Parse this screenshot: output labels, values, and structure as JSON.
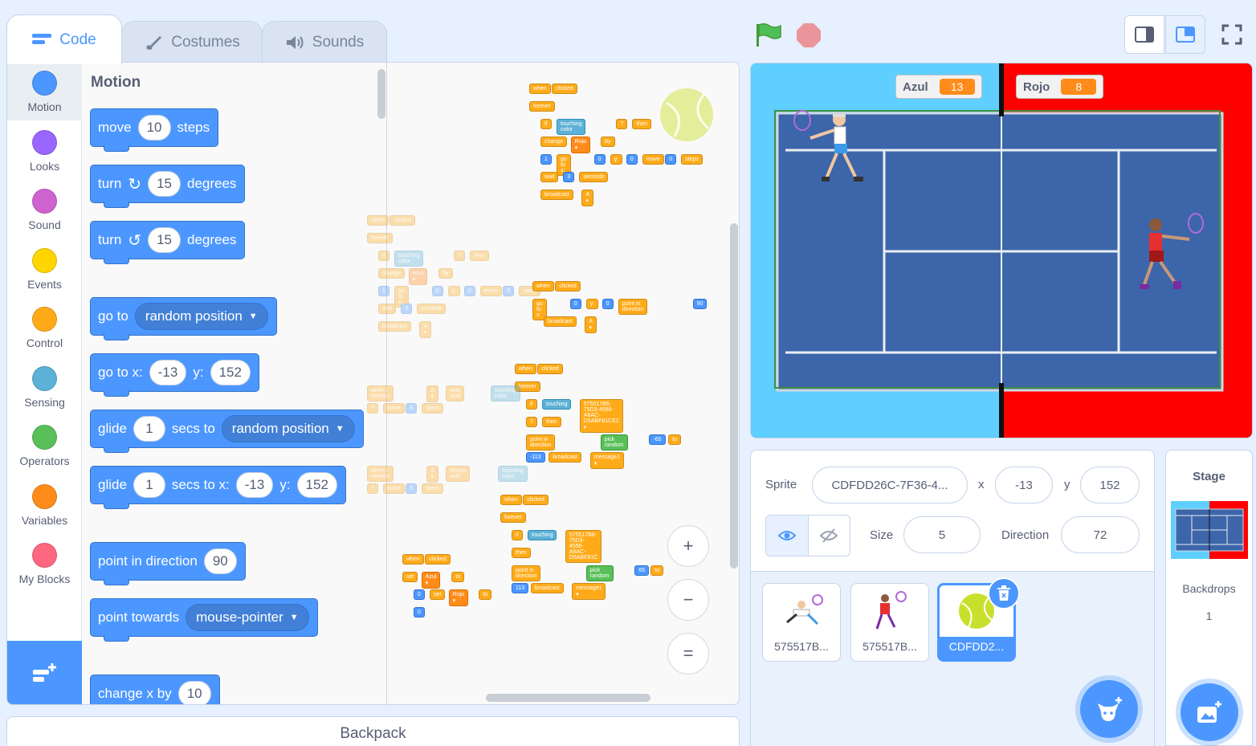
{
  "tabs": {
    "code": "Code",
    "costumes": "Costumes",
    "sounds": "Sounds"
  },
  "categories": [
    {
      "label": "Motion",
      "color": "#4c97ff"
    },
    {
      "label": "Looks",
      "color": "#9966ff"
    },
    {
      "label": "Sound",
      "color": "#cf63cf"
    },
    {
      "label": "Events",
      "color": "#ffd500"
    },
    {
      "label": "Control",
      "color": "#ffab19"
    },
    {
      "label": "Sensing",
      "color": "#5cb1d6"
    },
    {
      "label": "Operators",
      "color": "#59c059"
    },
    {
      "label": "Variables",
      "color": "#ff8c1a"
    },
    {
      "label": "My Blocks",
      "color": "#ff6680"
    }
  ],
  "palette": {
    "title": "Motion",
    "move": {
      "a": "move",
      "n": "10",
      "b": "steps"
    },
    "turn_right": {
      "a": "turn",
      "n": "15",
      "b": "degrees"
    },
    "turn_left": {
      "a": "turn",
      "n": "15",
      "b": "degrees"
    },
    "go_to": {
      "a": "go to",
      "menu": "random position"
    },
    "go_to_xy": {
      "a": "go to x:",
      "x": "-13",
      "b": "y:",
      "y": "152"
    },
    "glide_to": {
      "a": "glide",
      "n": "1",
      "b": "secs to",
      "menu": "random position"
    },
    "glide_xy": {
      "a": "glide",
      "n": "1",
      "b": "secs to x:",
      "x": "-13",
      "c": "y:",
      "y": "152"
    },
    "point_dir": {
      "a": "point in direction",
      "n": "90"
    },
    "point_towards": {
      "a": "point towards",
      "menu": "mouse-pointer"
    },
    "change_x": {
      "a": "change x by",
      "n": "10"
    }
  },
  "scripts": {
    "s1": [
      "when",
      "clicked",
      "forever",
      "if",
      "touching color",
      "?",
      "then",
      "change",
      "Rojo ▾",
      "by",
      "1",
      "go to x:",
      "0",
      "y:",
      "0",
      "move",
      "0",
      "steps",
      "wait",
      "3",
      "seconds",
      "broadcast",
      "A ▾"
    ],
    "s2": [
      "when",
      "clicked",
      "forever",
      "if",
      "touching color",
      "?",
      "then",
      "change",
      "Azul ▾",
      "by",
      "1",
      "go to x:",
      "0",
      "y:",
      "0",
      "move",
      "0",
      "steps",
      "wait",
      "3",
      "seconds",
      "broadcast",
      "A ▾"
    ],
    "s3": [
      "when",
      "clicked",
      "go to x:",
      "0",
      "y:",
      "0",
      "point in direction",
      "90",
      "broadcast",
      "A ▾"
    ],
    "s4": [
      "when",
      "clicked",
      "forever",
      "if",
      "touching",
      "575517B6-75D3-4556-A6AC-D5ABF81CE2 ▾",
      "?",
      "then",
      "point in direction",
      "pick random",
      "-65",
      "to",
      "-113",
      "broadcast",
      "message1 ▾"
    ],
    "s5": [
      "when I receive",
      "A ▾",
      "wait until",
      "touching color",
      "?",
      "move",
      "5",
      "steps"
    ],
    "s6": [
      "when I receive",
      "A ▾",
      "repeat until",
      "touching color",
      "?",
      "move",
      "5",
      "steps"
    ],
    "s7": [
      "when",
      "clicked",
      "set",
      "Azul ▾",
      "to",
      "0",
      "set",
      "Rojo ▾",
      "to",
      "0"
    ],
    "s8": [
      "when",
      "clicked",
      "forever",
      "if",
      "touching",
      "575517B6-75D3-4556-A6AC-D5ABF81C",
      "then",
      "point in direction",
      "pick random",
      "65",
      "to",
      "113",
      "broadcast",
      "message1 ▾"
    ]
  },
  "zoom": {
    "in": "+",
    "out": "−",
    "reset": "="
  },
  "backpack": "Backpack",
  "stage": {
    "score_azul": {
      "name": "Azul",
      "value": "13"
    },
    "score_rojo": {
      "name": "Rojo",
      "value": "8"
    }
  },
  "sprite_info": {
    "sprite_label": "Sprite",
    "sprite_name": "CDFDD26C-7F36-4...",
    "x_label": "x",
    "x_value": "-13",
    "y_label": "y",
    "y_value": "152",
    "size_label": "Size",
    "size_value": "5",
    "direction_label": "Direction",
    "direction_value": "72"
  },
  "sprites": [
    {
      "name": "575517B..."
    },
    {
      "name": "575517B..."
    },
    {
      "name": "CDFDD2..."
    }
  ],
  "stage_pane": {
    "title": "Stage",
    "backdrops_label": "Backdrops",
    "backdrops_count": "1"
  },
  "colors": {
    "accent": "#4c97ff",
    "motion": "#4c97ff",
    "control": "#ffab19",
    "stage_left": "#5fcfff",
    "stage_right": "#ff0000",
    "court": "#3d65a9"
  }
}
